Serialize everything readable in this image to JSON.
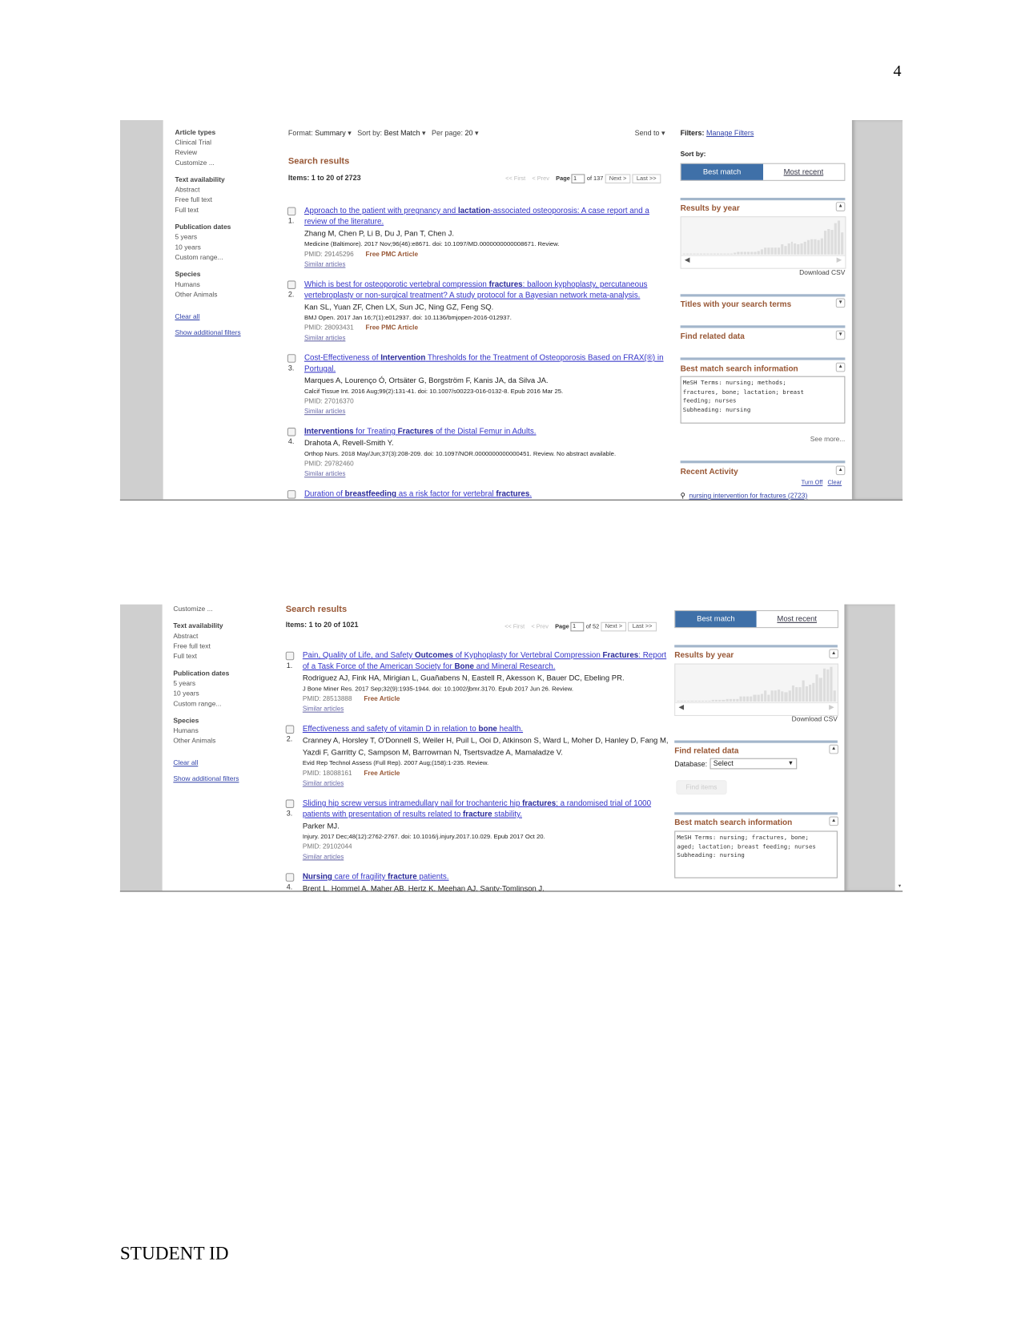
{
  "page_number": "4",
  "footer": "STUDENT ID",
  "colors": {
    "accent_blue": "#3f70a8",
    "header_brown": "#985735",
    "link": "#3535c8",
    "panel_bar": "#a3b6cb"
  },
  "shot1": {
    "sidebar": {
      "groups": [
        {
          "heading": "Article types",
          "items": [
            "Clinical Trial",
            "Review",
            "Customize ..."
          ]
        },
        {
          "heading": "Text availability",
          "items": [
            "Abstract",
            "Free full text",
            "Full text"
          ]
        },
        {
          "heading": "Publication dates",
          "items": [
            "5 years",
            "10 years",
            "Custom range..."
          ]
        },
        {
          "heading": "Species",
          "items": [
            "Humans",
            "Other Animals"
          ]
        }
      ],
      "links": [
        "Clear all",
        "Show additional filters"
      ]
    },
    "toolbar": {
      "format_label": "Format:",
      "format_value": "Summary",
      "sortby_label": "Sort by:",
      "sortby_value": "Best Match",
      "perpage_label": "Per page:",
      "perpage_value": "20",
      "send_to": "Send to"
    },
    "filters_label": "Filters:",
    "manage_filters": "Manage Filters",
    "search_results": "Search results",
    "items": "Items: 1 to 20 of 2723",
    "pager": {
      "first": "<< First",
      "prev": "< Prev",
      "page_label": "Page",
      "page_value": "1",
      "of": "of 137",
      "next": "Next >",
      "last": "Last >>"
    },
    "sort_by": "Sort by:",
    "best_match": "Best match",
    "most_recent": "Most recent",
    "results_by_year": "Results by year",
    "download_csv": "Download CSV",
    "histogram_levels": [
      0.02,
      0,
      0.02,
      0.02,
      0.02,
      0.02,
      0.02,
      0.02,
      0.02,
      0.02,
      0.02,
      0.02,
      0.02,
      0.03,
      0.03,
      0.05,
      0.06,
      0.06,
      0.06,
      0.07,
      0.07,
      0.08,
      0.1,
      0.14,
      0.18,
      0.18,
      0.18,
      0.2,
      0.2,
      0.28,
      0.24,
      0.3,
      0.36,
      0.3,
      0.28,
      0.3,
      0.36,
      0.4,
      0.42,
      0.44,
      0.4,
      0.46,
      0.66,
      0.72,
      0.68,
      0.88,
      0.95,
      0.62
    ],
    "titles_with_terms": "Titles with your search terms",
    "find_related": "Find related data",
    "best_match_info": "Best match search information",
    "mesh_text": "MeSH Terms: nursing; methods;\nfractures, bone; lactation; breast\nfeeding; nurses\nSubheading: nursing",
    "see_more": "See more...",
    "recent_activity": "Recent Activity",
    "turn_off": "Turn Off",
    "clear": "Clear",
    "recent_query": "nursing intervention for fractures (2723)",
    "results": [
      {
        "num": "1.",
        "title": [
          {
            "t": "Approach to the patient with pregnancy and "
          },
          {
            "t": "lactation",
            "b": true
          },
          {
            "t": "-associated osteoporosis: A case report and a review of the literature."
          }
        ],
        "authors": "Zhang M, Chen P, Li B, Du J, Pan T, Chen J.",
        "citation": "Medicine (Baltimore). 2017 Nov;96(46):e8671. doi: 10.1097/MD.0000000000008671. Review.",
        "pmid": "PMID: 29145296",
        "free": "Free PMC Article",
        "similar": "Similar articles"
      },
      {
        "num": "2.",
        "title": [
          {
            "t": "Which is best for osteoporotic vertebral compression "
          },
          {
            "t": "fractures",
            "b": true
          },
          {
            "t": ": balloon kyphoplasty, percutaneous vertebroplasty or non-surgical treatment? A study protocol for a Bayesian network meta-analysis."
          }
        ],
        "authors": "Kan SL, Yuan ZF, Chen LX, Sun JC, Ning GZ, Feng SQ.",
        "citation": "BMJ Open. 2017 Jan 16;7(1):e012937. doi: 10.1136/bmjopen-2016-012937.",
        "pmid": "PMID: 28093431",
        "free": "Free PMC Article",
        "similar": "Similar articles"
      },
      {
        "num": "3.",
        "title": [
          {
            "t": "Cost-Effectiveness of "
          },
          {
            "t": "Intervention",
            "b": true
          },
          {
            "t": " Thresholds for the Treatment of Osteoporosis Based on FRAX(®) in Portugal."
          }
        ],
        "authors": "Marques A, Lourenço Ó, Ortsäter G, Borgström F, Kanis JA, da Silva JA.",
        "citation": "Calcif Tissue Int. 2016 Aug;99(2):131-41. doi: 10.1007/s00223-016-0132-8. Epub 2016 Mar 25.",
        "pmid": "PMID: 27016370",
        "similar": "Similar articles"
      },
      {
        "num": "4.",
        "title": [
          {
            "t": "Interventions",
            "b": true
          },
          {
            "t": " for Treating "
          },
          {
            "t": "Fractures",
            "b": true
          },
          {
            "t": " of the Distal Femur in Adults."
          }
        ],
        "authors": "Drahota A, Revell-Smith Y.",
        "citation": "Orthop Nurs. 2018 May/Jun;37(3):208-209. doi: 10.1097/NOR.0000000000000451. Review. No abstract available.",
        "pmid": "PMID: 29782460",
        "similar": "Similar articles"
      },
      {
        "num": "5.",
        "title": [
          {
            "t": "Duration of "
          },
          {
            "t": "breastfeeding",
            "b": true
          },
          {
            "t": " as a risk factor for vertebral "
          },
          {
            "t": "fractures",
            "b": true
          },
          {
            "t": "."
          }
        ]
      }
    ]
  },
  "shot2": {
    "sidebar": {
      "groups": [
        {
          "heading": "",
          "items": [
            "Customize ..."
          ]
        },
        {
          "heading": "Text availability",
          "items": [
            "Abstract",
            "Free full text",
            "Full text"
          ]
        },
        {
          "heading": "Publication dates",
          "items": [
            "5 years",
            "10 years",
            "Custom range..."
          ]
        },
        {
          "heading": "Species",
          "items": [
            "Humans",
            "Other Animals"
          ]
        }
      ],
      "links": [
        "Clear all",
        "Show additional filters"
      ]
    },
    "search_results": "Search results",
    "items": "Items: 1 to 20 of 1021",
    "pager": {
      "first": "<< First",
      "prev": "< Prev",
      "page_label": "Page",
      "page_value": "1",
      "of": "of 52",
      "next": "Next >",
      "last": "Last >>"
    },
    "best_match": "Best match",
    "most_recent": "Most recent",
    "results_by_year": "Results by year",
    "download_csv": "Download CSV",
    "histogram_levels": [
      0,
      0.02,
      0,
      0.03,
      0.03,
      0,
      0.02,
      0.02,
      0.03,
      0.03,
      0.04,
      0.04,
      0.05,
      0.05,
      0.06,
      0.07,
      0.08,
      0.06,
      0.14,
      0.14,
      0.15,
      0.14,
      0.2,
      0.18,
      0.22,
      0.3,
      0.18,
      0.3,
      0.3,
      0.34,
      0.28,
      0.26,
      0.3,
      0.46,
      0.4,
      0.4,
      0.6,
      0.42,
      0.48,
      0.52,
      0.76,
      0.66,
      0.94,
      0.9,
      0.98,
      0.3
    ],
    "find_related": "Find related data",
    "database_label": "Database:",
    "database_value": "Select",
    "find_items": "Find items",
    "best_match_info": "Best match search information",
    "mesh_text": "MeSH Terms: nursing; fractures, bone;\naged; lactation; breast feeding; nurses\nSubheading: nursing",
    "results": [
      {
        "num": "1.",
        "title": [
          {
            "t": "Pain, Quality of Life, and Safety "
          },
          {
            "t": "Outcomes",
            "b": true
          },
          {
            "t": " of Kyphoplasty for Vertebral Compression "
          },
          {
            "t": "Fractures",
            "b": true
          },
          {
            "t": ": Report of a Task Force of the American Society for "
          },
          {
            "t": "Bone",
            "b": true
          },
          {
            "t": " and Mineral Research."
          }
        ],
        "authors": "Rodriguez AJ, Fink HA, Mirigian L, Guañabens N, Eastell R, Akesson K, Bauer DC, Ebeling PR.",
        "citation": "J Bone Miner Res. 2017 Sep;32(9):1935-1944. doi: 10.1002/jbmr.3170. Epub 2017 Jun 26. Review.",
        "pmid": "PMID: 28513888",
        "free": "Free Article",
        "similar": "Similar articles"
      },
      {
        "num": "2.",
        "title": [
          {
            "t": "Effectiveness and safety of vitamin D in relation to "
          },
          {
            "t": "bone",
            "b": true
          },
          {
            "t": " health."
          }
        ],
        "authors": "Cranney A, Horsley T, O'Donnell S, Weiler H, Puil L, Ooi D, Atkinson S, Ward L, Moher D, Hanley D, Fang M, Yazdi F, Garritty C, Sampson M, Barrowman N, Tsertsvadze A, Mamaladze V.",
        "citation": "Evid Rep Technol Assess (Full Rep). 2007 Aug;(158):1-235. Review.",
        "pmid": "PMID: 18088161",
        "free": "Free Article",
        "similar": "Similar articles"
      },
      {
        "num": "3.",
        "title": [
          {
            "t": "Sliding hip screw versus intramedullary nail for trochanteric hip "
          },
          {
            "t": "fractures",
            "b": true
          },
          {
            "t": "; a randomised trial of 1000 patients with presentation of results related to "
          },
          {
            "t": "fracture",
            "b": true
          },
          {
            "t": " stability."
          }
        ],
        "authors": "Parker MJ.",
        "citation": "Injury. 2017 Dec;48(12):2762-2767. doi: 10.1016/j.injury.2017.10.029. Epub 2017 Oct 20.",
        "pmid": "PMID: 29102044",
        "similar": "Similar articles"
      },
      {
        "num": "4.",
        "title": [
          {
            "t": "Nursing",
            "b": true
          },
          {
            "t": " care of fragility "
          },
          {
            "t": "fracture",
            "b": true
          },
          {
            "t": " patients."
          }
        ],
        "authors": "Brent L, Hommel A, Maher AB, Hertz K, Meehan AJ, Santy-Tomlinson J."
      }
    ]
  }
}
